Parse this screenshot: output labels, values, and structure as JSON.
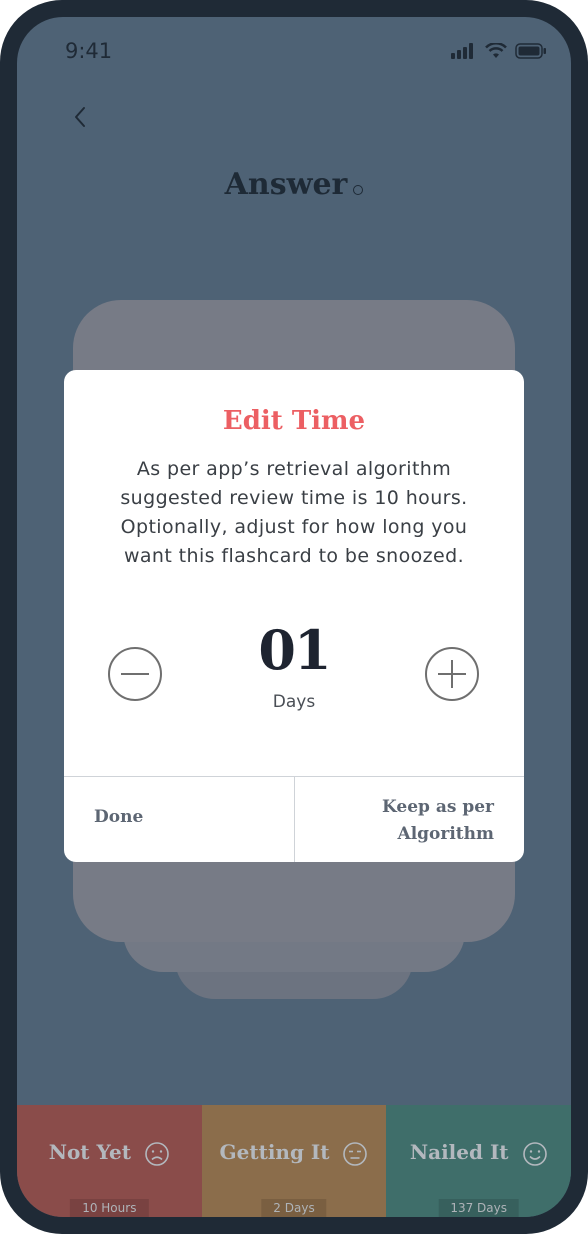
{
  "status": {
    "time": "9:41"
  },
  "header": {
    "title": "Answer"
  },
  "modal": {
    "title": "Edit Time",
    "message": "As per app’s retrieval algorithm suggested review time is 10 hours. Optionally, adjust for how long you want this flashcard to be snoozed.",
    "count": "01",
    "unit": "Days",
    "done_label": "Done",
    "keep_label": "Keep as per Algorithm"
  },
  "ratings": [
    {
      "label": "Not Yet",
      "time": "10 Hours",
      "face": "sad-face-icon"
    },
    {
      "label": "Getting It",
      "time": "2 Days",
      "face": "neutral-face-icon"
    },
    {
      "label": "Nailed It",
      "time": "137 Days",
      "face": "happy-face-icon"
    }
  ],
  "colors": {
    "accent": "#ec5f63",
    "background": "#4e6275",
    "not_yet": "#8a4c4a",
    "getting_it": "#8b6d4b",
    "nailed_it": "#3f6e6a"
  }
}
